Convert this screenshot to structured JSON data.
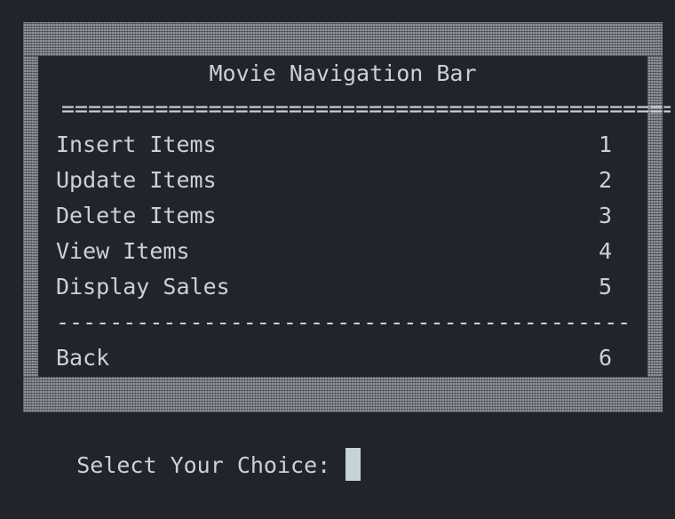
{
  "menu": {
    "title": "Movie Navigation Bar",
    "separator_top": "================================================",
    "items": [
      {
        "label": "Insert Items",
        "key": "1"
      },
      {
        "label": "Update Items",
        "key": "2"
      },
      {
        "label": "Delete Items",
        "key": "3"
      },
      {
        "label": "View Items",
        "key": "4"
      },
      {
        "label": "Display Sales",
        "key": "5"
      }
    ],
    "separator_bottom": "--------------------------------------------",
    "back": {
      "label": "Back",
      "key": "6"
    }
  },
  "prompt": {
    "text": "Select Your Choice: "
  },
  "colors": {
    "background": "#21252b",
    "text": "#c9d1d9",
    "border_shade": "#8f9399"
  }
}
